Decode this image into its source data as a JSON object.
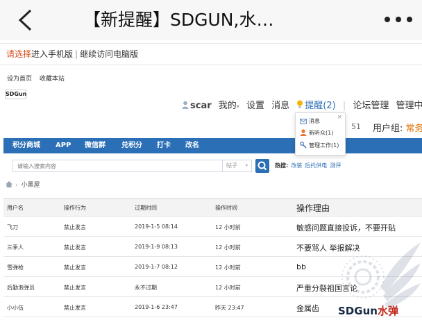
{
  "appbar": {
    "title": "【新提醒】SDGUN,水…",
    "back_icon": "chevron-left-icon",
    "more_icon": "more-dots-icon"
  },
  "notice": {
    "prompt": "请选择",
    "mobile": "进入手机版",
    "separator": "|",
    "desktop": "继续访问电脑版"
  },
  "toplinks": {
    "set_home": "设为首页",
    "bookmark": "收藏本站"
  },
  "logo": {
    "text": "SDGun"
  },
  "usernav": {
    "username": "scar",
    "my": "我的",
    "caret": "▾",
    "settings": "设置",
    "messages": "消息",
    "reminder": "提醒(2)",
    "pipe": "|",
    "forum_admin": "论坛管理",
    "admin_center": "管理中心"
  },
  "second_row": {
    "fragment": "51",
    "group_label": "用户组:",
    "group_value": "常务"
  },
  "popup": {
    "close": "×",
    "items": [
      {
        "label": "消息",
        "icon": "envelope-icon"
      },
      {
        "label": "新听众(1)",
        "icon": "user-icon"
      },
      {
        "label": "管理工作(1)",
        "icon": "wrench-icon"
      }
    ]
  },
  "bluenav": {
    "items": [
      "积分商城",
      "APP",
      "微信群",
      "兑积分",
      "打卡",
      "改名"
    ]
  },
  "search": {
    "placeholder": "请输入搜索内容",
    "type": "帖子",
    "caret": "▾",
    "hot_label": "热搜:",
    "hot_keywords": [
      "改装",
      "后托供电",
      "测评"
    ]
  },
  "breadcrumb": {
    "separator": "›",
    "current": "小黑屋"
  },
  "table": {
    "headers": [
      "用户名",
      "操作行为",
      "过期时间",
      "操作时间",
      "操作理由"
    ],
    "rows": [
      [
        "飞刀",
        "禁止发言",
        "2019-1-5 08:14",
        "12 小时前",
        "敏感问题直接投诉，不要开贴"
      ],
      [
        "三季人",
        "禁止发言",
        "2019-1-9 08:13",
        "12 小时前",
        "不要骂人 举报解决"
      ],
      [
        "雪弹枪",
        "禁止发言",
        "2019-1-7 08:12",
        "12 小时前",
        "bb"
      ],
      [
        "后勤泡弹员",
        "禁止发言",
        "永不过期",
        "12 小时前",
        "严重分裂祖国言论"
      ],
      [
        "小小伍",
        "禁止发言",
        "2019-1-6 23:47",
        "昨天 23:47",
        "金属齿"
      ]
    ]
  },
  "watermark": {
    "brand": "SDGun",
    "suffix": "水弹"
  }
}
